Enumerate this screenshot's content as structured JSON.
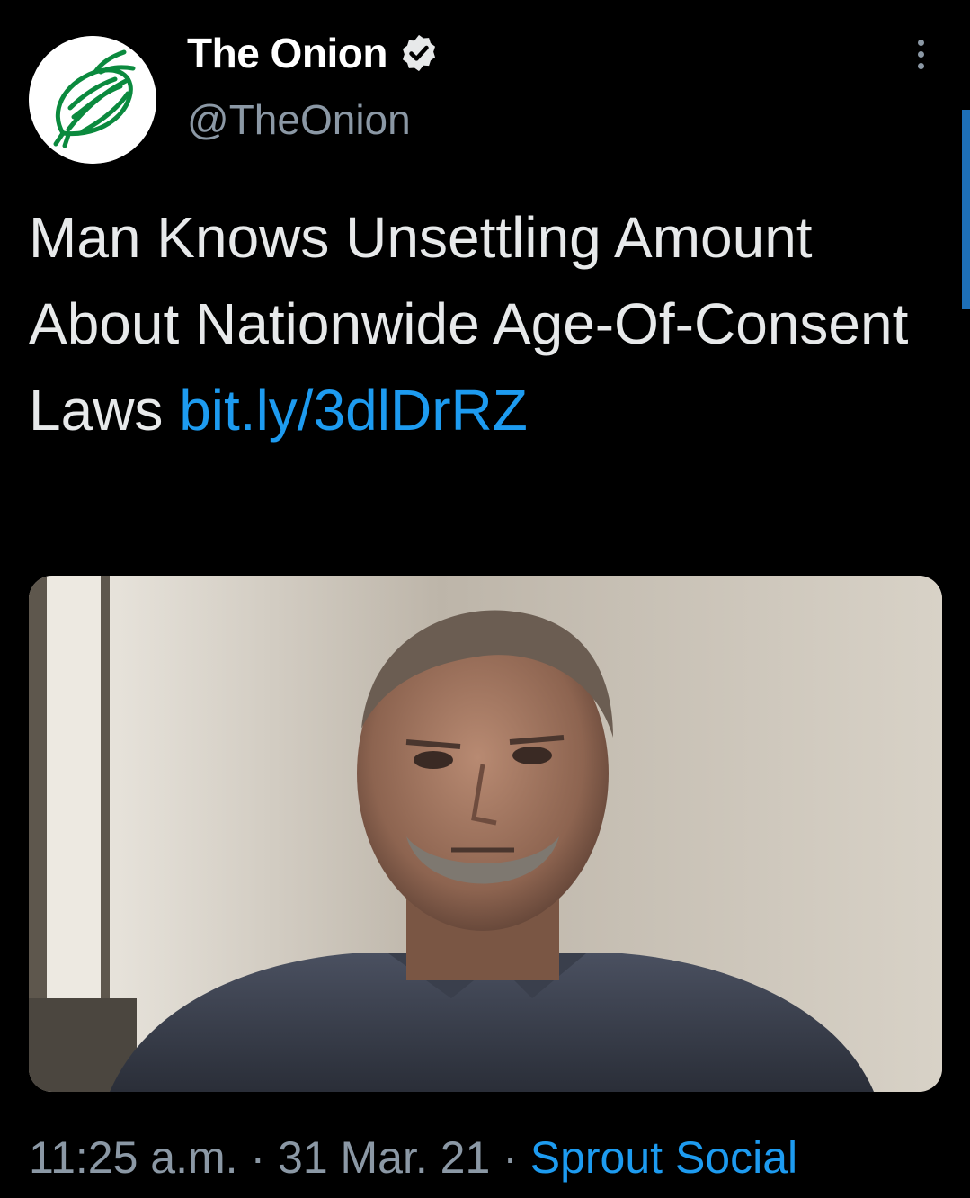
{
  "author": {
    "display_name": "The Onion",
    "handle": "@TheOnion",
    "avatar_icon": "onion-logo-icon",
    "verified_icon": "verified-badge-icon"
  },
  "tweet": {
    "text": "Man Knows Unsettling Amount About Nationwide Age-Of-Consent Laws",
    "link": "bit.ly/3dlDrRZ",
    "image_description": "photo-man-portrait"
  },
  "meta": {
    "time": "11:25 a.m.",
    "separator": "·",
    "date": "31 Mar. 21",
    "source": "Sprout Social"
  },
  "menu": {
    "more_icon": "more-options-icon"
  },
  "colors": {
    "background": "#000000",
    "text": "#e7e9ea",
    "secondary": "#8b98a5",
    "link": "#1d9bf0",
    "onion_green": "#0b8a3e"
  }
}
